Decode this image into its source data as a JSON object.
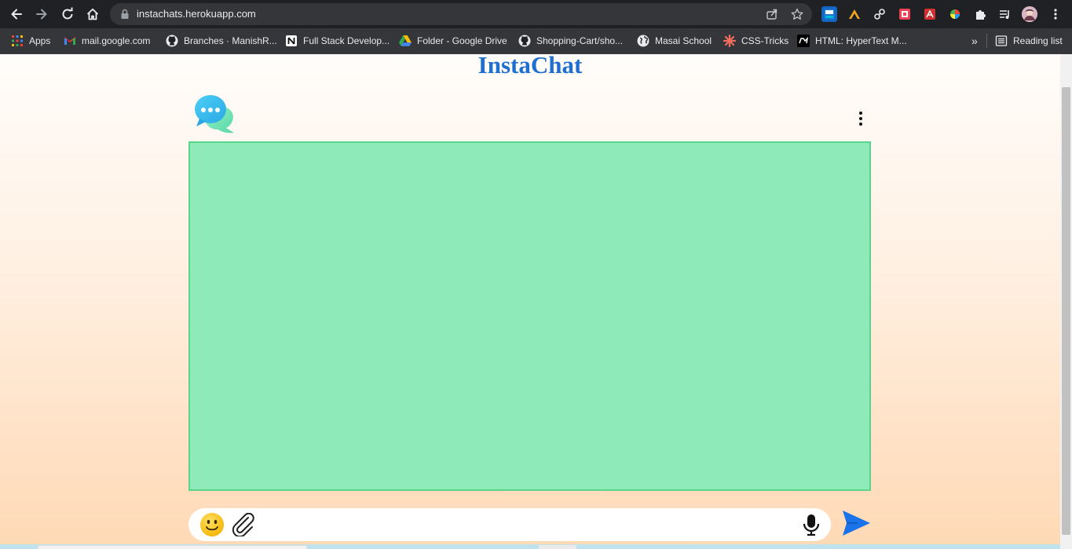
{
  "browser": {
    "url": "instachats.herokuapp.com",
    "bookmarks": [
      {
        "label": "Apps",
        "icon": "apps-grid-icon"
      },
      {
        "label": "mail.google.com",
        "icon": "gmail-icon"
      },
      {
        "label": "Branches · ManishR...",
        "icon": "github-icon"
      },
      {
        "label": "Full Stack Develop...",
        "icon": "notion-icon"
      },
      {
        "label": "Folder - Google Drive",
        "icon": "google-drive-icon"
      },
      {
        "label": "Shopping-Cart/sho...",
        "icon": "github-icon"
      },
      {
        "label": "Masai School",
        "icon": "globe-icon"
      },
      {
        "label": "CSS-Tricks",
        "icon": "css-tricks-icon"
      },
      {
        "label": "HTML: HyperText M...",
        "icon": "mdn-icon"
      }
    ],
    "overflow_label": "»",
    "reading_list_label": "Reading list"
  },
  "page": {
    "title": "InstaChat",
    "message_placeholder": ""
  },
  "colors": {
    "title": "#1f6fd1",
    "chat_area": "#8eeab8",
    "chat_border": "#5bd38d",
    "send": "#1a73e8"
  }
}
